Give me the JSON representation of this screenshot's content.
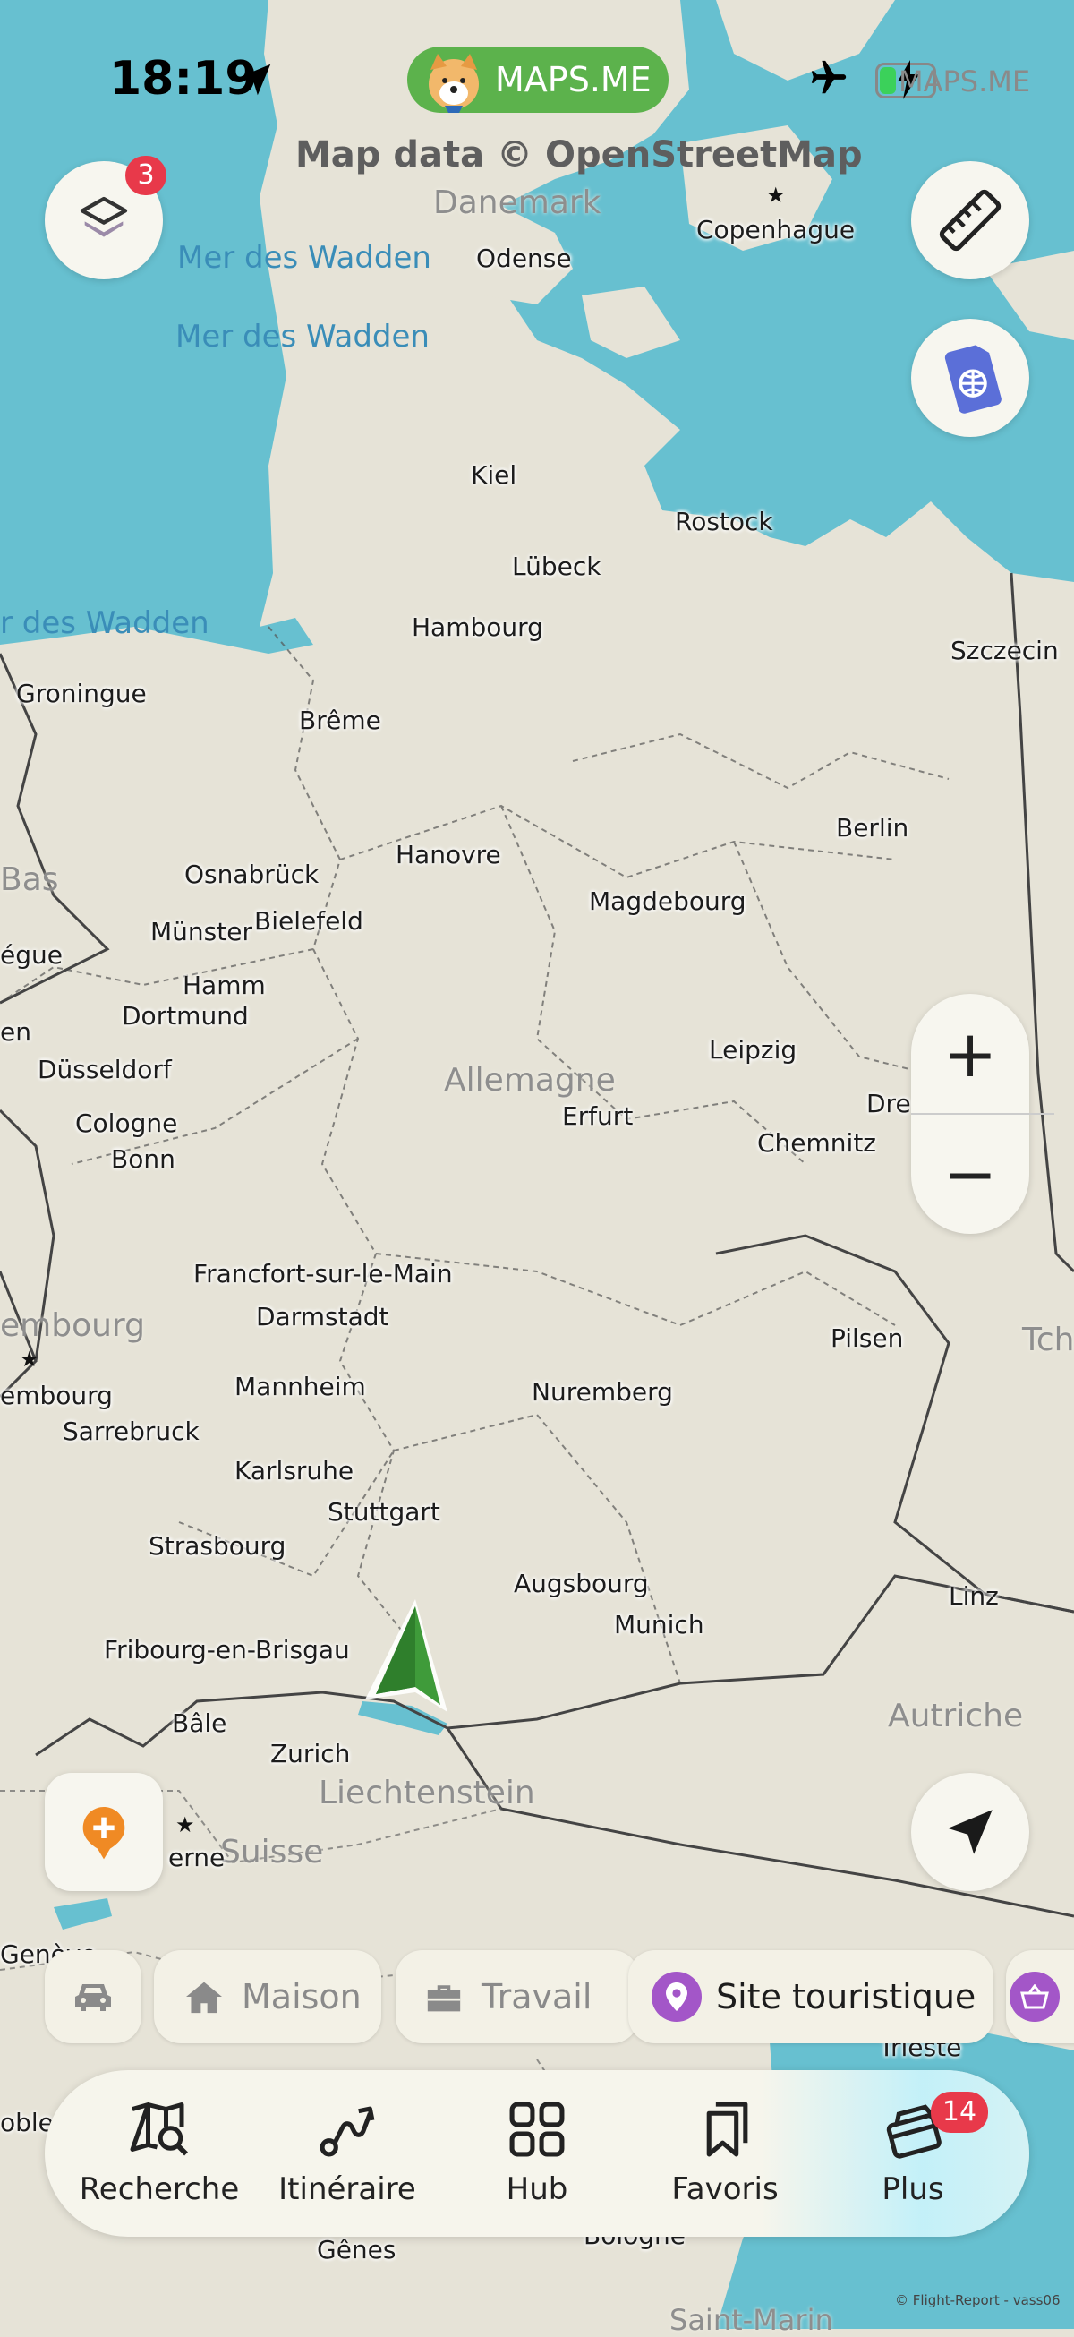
{
  "status_bar": {
    "time": "18:19",
    "app_pill": "MAPS.ME",
    "carrier_label": "MAPS.ME"
  },
  "map": {
    "attribution": "Map data © OpenStreetMap",
    "countries": [
      "Danemark",
      "Allemagne",
      "Liechtenstein",
      "Suisse",
      "Autriche",
      "Bas",
      "embourg",
      "Tch"
    ],
    "seas": [
      "Mer des Wadden",
      "Mer des Wadden",
      "r des Wadden"
    ],
    "cities": [
      "Copenhague",
      "Odense",
      "Kiel",
      "Rostock",
      "Lübeck",
      "Hambourg",
      "Szczecin",
      "Groningue",
      "Brême",
      "Berlin",
      "Hanovre",
      "Osnabrück",
      "Magdebourg",
      "Münster",
      "Bielefeld",
      "égue",
      "Hamm",
      "Dortmund",
      "Leipzig",
      "en",
      "Düsseldorf",
      "Dre",
      "Erfurt",
      "Cologne",
      "Chemnitz",
      "Bonn",
      "Francfort-sur-le-Main",
      "Darmstadt",
      "Pilsen",
      "embourg",
      "Mannheim",
      "Nuremberg",
      "Sarrebruck",
      "Karlsruhe",
      "Stuttgart",
      "Strasbourg",
      "Augsbourg",
      "Munich",
      "Linz",
      "Fribourg-en-Brisgau",
      "Bâle",
      "Zurich",
      "erne",
      "Genève",
      "Trieste",
      "Gênes",
      "Bologne",
      "oble",
      "Saint-Marin"
    ]
  },
  "buttons": {
    "layers_badge": "3",
    "layers_icon": "layers-icon",
    "ruler_icon": "ruler-icon",
    "esim_icon": "esim-icon",
    "zoom_in": "+",
    "zoom_out": "−",
    "add_place_icon": "plus-icon",
    "locate_icon": "navigation-arrow-icon"
  },
  "chips": [
    {
      "icon": "car-icon",
      "label": ""
    },
    {
      "icon": "home-icon",
      "label": "Maison"
    },
    {
      "icon": "briefcase-icon",
      "label": "Travail"
    },
    {
      "icon": "poi-pin-icon",
      "label": "Site touristique"
    },
    {
      "icon": "basket-icon",
      "label": ""
    }
  ],
  "tabs": [
    {
      "icon": "map-search-icon",
      "label": "Recherche"
    },
    {
      "icon": "route-icon",
      "label": "Itinéraire"
    },
    {
      "icon": "grid-icon",
      "label": "Hub"
    },
    {
      "icon": "bookmarks-icon",
      "label": "Favoris"
    },
    {
      "icon": "more-icon",
      "label": "Plus",
      "badge": "14"
    }
  ],
  "copyright": "© Flight-Report - vass06",
  "colors": {
    "water": "#67c0d0",
    "land": "#e6e3d7",
    "brand_green": "#5cb24c",
    "badge_red": "#e8394a",
    "poi_purple": "#a356c8",
    "add_orange": "#f08a24"
  }
}
